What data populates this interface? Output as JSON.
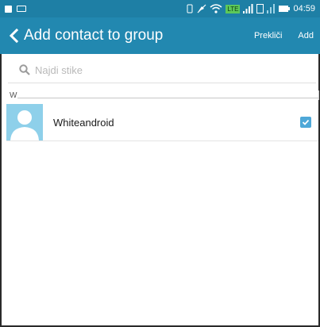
{
  "status_bar": {
    "time": "04:59",
    "icons": [
      "document-icon",
      "message-icon",
      "vibrate-icon",
      "mute-icon",
      "wifi-icon",
      "lte-icon",
      "signal-icon",
      "sim-icon",
      "battery-icon"
    ],
    "lte_label": "LTE"
  },
  "header": {
    "title": "Add contact to group",
    "cancel_label": "Prekliči",
    "add_label": "Add"
  },
  "search": {
    "placeholder": "Najdi stike"
  },
  "section": {
    "letter": "W"
  },
  "contacts": [
    {
      "name": "Whiteandroid",
      "checked": true
    }
  ],
  "colors": {
    "status_bar": "#1e7fa5",
    "action_bar": "#2288b0",
    "avatar_bg": "#8ed0ea",
    "checkbox": "#4ea8d8"
  }
}
